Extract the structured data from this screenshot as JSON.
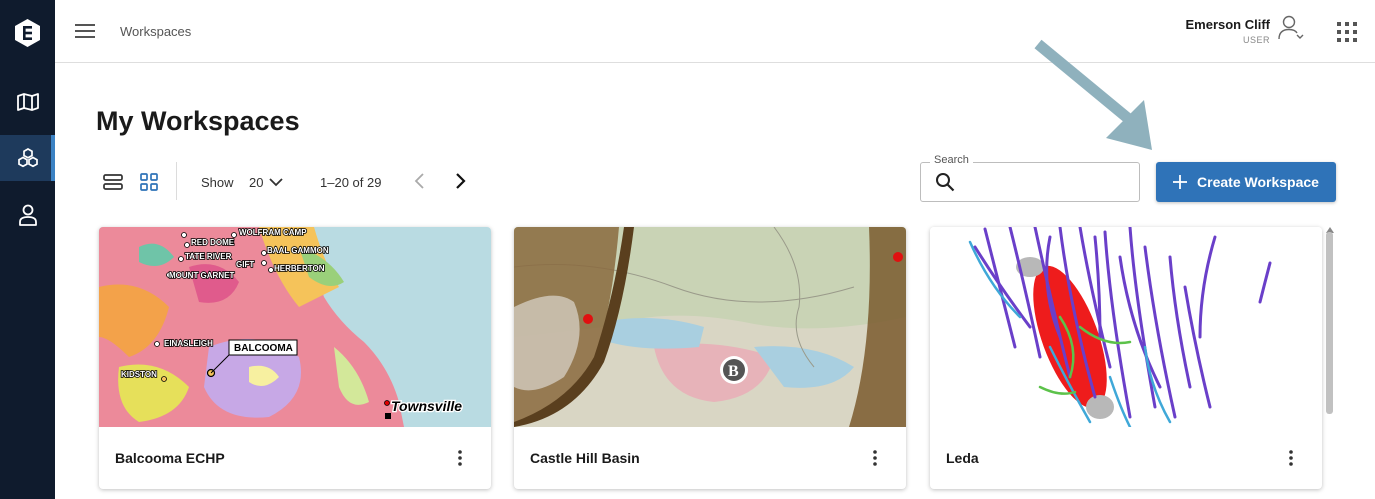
{
  "header": {
    "breadcrumb": "Workspaces",
    "user_name": "Emerson Cliff",
    "user_role": "USER"
  },
  "icons": {
    "logo": "brand-logo-icon",
    "rail": [
      "map-icon",
      "workspaces-icon",
      "profile-icon"
    ],
    "menu": "hamburger-icon",
    "user": "user-account-icon",
    "apps": "apps-grid-icon",
    "search": "search-icon",
    "add": "plus-icon",
    "kebab": "more-vert-icon"
  },
  "page": {
    "title": "My Workspaces"
  },
  "toolbar": {
    "show_label": "Show",
    "page_size": "20",
    "range": "1–20 of 29"
  },
  "search": {
    "label": "Search",
    "value": ""
  },
  "create_button": {
    "label": "Create Workspace"
  },
  "cards": [
    {
      "title": "Balcooma ECHP",
      "map_labels": [
        "WOLFRAM CAMP",
        "RED DOME",
        "BAAL GAMMON",
        "TATE RIVER",
        "GIFT",
        "HERBERTON",
        "MOUNT GARNET",
        "EINASLEIGH",
        "BALCOOMA",
        "KIDSTON",
        "Townsville"
      ]
    },
    {
      "title": "Castle Hill Basin",
      "map_labels": [
        "B"
      ]
    },
    {
      "title": "Leda"
    }
  ],
  "colors": {
    "rail_bg": "#0f1b2d",
    "rail_active": "#1e3a5c",
    "accent": "#2f73b8",
    "arrow": "#8fb1bd"
  }
}
